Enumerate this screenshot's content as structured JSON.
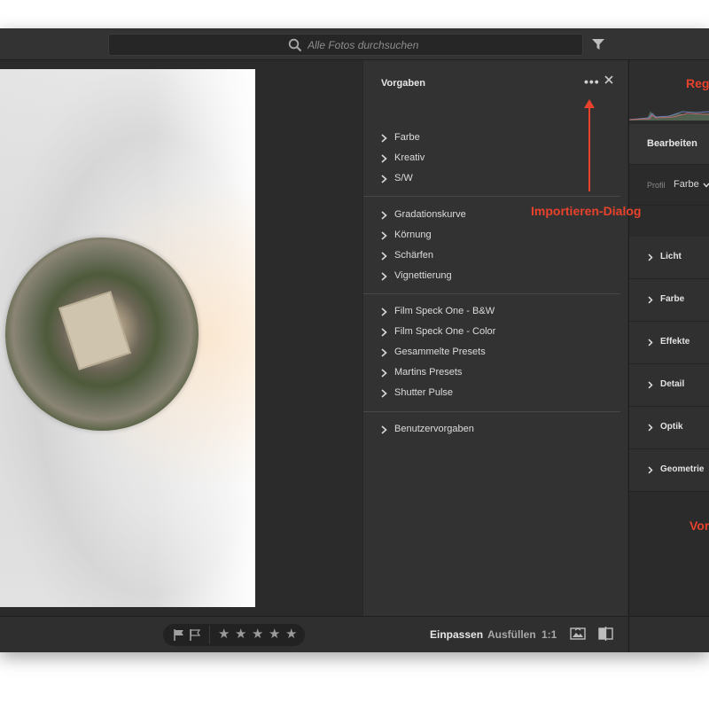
{
  "search": {
    "placeholder": "Alle Fotos durchsuchen"
  },
  "presets": {
    "title": "Vorgaben",
    "more": "•••",
    "groups": [
      [
        "Farbe",
        "Kreativ",
        "S/W"
      ],
      [
        "Gradationskurve",
        "Körnung",
        "Schärfen",
        "Vignettierung"
      ],
      [
        "Film Speck One - B&W",
        "Film Speck One - Color",
        "Gesammelte Presets",
        "Martins Presets",
        "Shutter Pulse"
      ],
      [
        "Benutzervorgaben"
      ]
    ]
  },
  "edit": {
    "title": "Bearbeiten",
    "profile_label": "Profil",
    "profile_value": "Farbe",
    "sections": [
      "Licht",
      "Farbe",
      "Effekte",
      "Detail",
      "Optik",
      "Geometrie"
    ]
  },
  "bottombar": {
    "stars": [
      "★",
      "★",
      "★",
      "★",
      "★"
    ],
    "zoom_fit": "Einpassen",
    "zoom_fill": "Ausfüllen",
    "zoom_1to1": "1:1"
  },
  "annotations": {
    "import_dialog": "Importieren-Dialog",
    "right_top": "Reg",
    "right_bottom": "Vor",
    "color": "#e8422c"
  },
  "icons": [
    "search-icon",
    "filter-icon",
    "chevron-right-icon",
    "more-icon",
    "close-icon",
    "flag-pick-icon",
    "flag-reject-icon",
    "star-icon",
    "compare-icon",
    "split-view-icon"
  ]
}
